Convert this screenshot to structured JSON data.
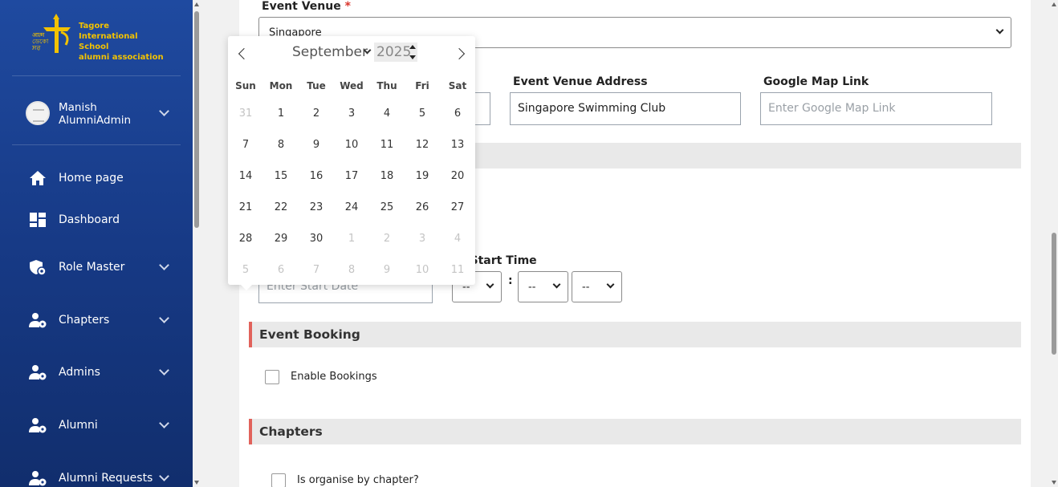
{
  "sidebar": {
    "logo_text": [
      "Tagore",
      "International School",
      "alumni association"
    ],
    "profile": {
      "name_line1": "Manish",
      "name_line2": "AlumniAdmin"
    },
    "items": [
      {
        "label": "Home page",
        "icon": "home-icon",
        "has_chevron": false
      },
      {
        "label": "Dashboard",
        "icon": "dashboard-icon",
        "has_chevron": false
      },
      {
        "label": "Role Master",
        "icon": "shield-gear-icon",
        "has_chevron": true
      },
      {
        "label": "Chapters",
        "icon": "user-gear-icon",
        "has_chevron": true
      },
      {
        "label": "Admins",
        "icon": "user-gear-icon",
        "has_chevron": true
      },
      {
        "label": "Alumni",
        "icon": "user-gear-icon",
        "has_chevron": true
      },
      {
        "label": "Alumni Requests",
        "icon": "user-gear-icon",
        "has_chevron": true
      }
    ]
  },
  "form": {
    "venue": {
      "label": "Event Venue",
      "required_mark": "*",
      "value": "Singapore"
    },
    "venue_address": {
      "label": "Event Venue Address",
      "value": "Singapore Swimming Club"
    },
    "map_link": {
      "label": "Google Map Link",
      "placeholder": "Enter Google Map Link"
    },
    "start_date": {
      "placeholder": "Enter Start Date"
    },
    "start_time": {
      "label_visible": "nt Start Time",
      "hour": "--",
      "separator": ":",
      "minute": "--",
      "ampm": "--"
    },
    "booking": {
      "title": "Event Booking",
      "checkbox_label": "Enable Bookings"
    },
    "chapters": {
      "title": "Chapters",
      "checkbox_label": "Is organise by chapter?"
    }
  },
  "datepicker": {
    "month": "September",
    "year": "2025",
    "weekdays": [
      "Sun",
      "Mon",
      "Tue",
      "Wed",
      "Thu",
      "Fri",
      "Sat"
    ],
    "weeks": [
      [
        {
          "d": "31",
          "o": true
        },
        {
          "d": "1"
        },
        {
          "d": "2"
        },
        {
          "d": "3"
        },
        {
          "d": "4"
        },
        {
          "d": "5"
        },
        {
          "d": "6"
        }
      ],
      [
        {
          "d": "7"
        },
        {
          "d": "8"
        },
        {
          "d": "9"
        },
        {
          "d": "10"
        },
        {
          "d": "11"
        },
        {
          "d": "12"
        },
        {
          "d": "13"
        }
      ],
      [
        {
          "d": "14"
        },
        {
          "d": "15"
        },
        {
          "d": "16"
        },
        {
          "d": "17"
        },
        {
          "d": "18"
        },
        {
          "d": "19"
        },
        {
          "d": "20"
        }
      ],
      [
        {
          "d": "21"
        },
        {
          "d": "22"
        },
        {
          "d": "23"
        },
        {
          "d": "24"
        },
        {
          "d": "25"
        },
        {
          "d": "26"
        },
        {
          "d": "27"
        }
      ],
      [
        {
          "d": "28"
        },
        {
          "d": "29"
        },
        {
          "d": "30"
        },
        {
          "d": "1",
          "o": true
        },
        {
          "d": "2",
          "o": true
        },
        {
          "d": "3",
          "o": true
        },
        {
          "d": "4",
          "o": true
        }
      ],
      [
        {
          "d": "5",
          "o": true
        },
        {
          "d": "6",
          "o": true
        },
        {
          "d": "7",
          "o": true
        },
        {
          "d": "8",
          "o": true
        },
        {
          "d": "9",
          "o": true
        },
        {
          "d": "10",
          "o": true
        },
        {
          "d": "11",
          "o": true
        }
      ]
    ]
  },
  "colors": {
    "sidebar": "#173a86",
    "logo_gold": "#f2c200",
    "section_accent": "#e1625b"
  }
}
